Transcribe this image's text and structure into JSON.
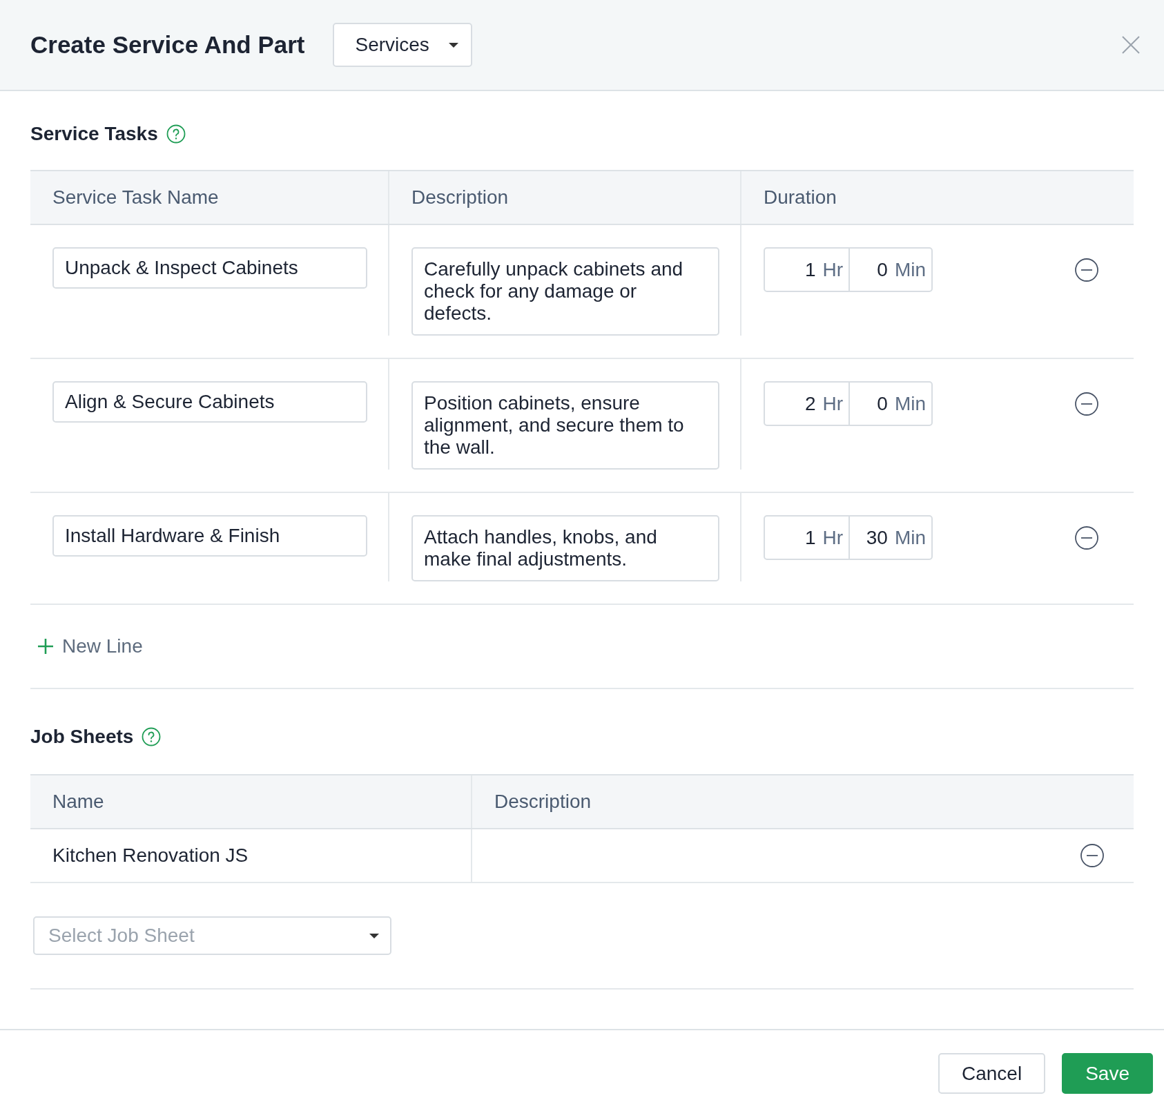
{
  "header": {
    "title": "Create Service And Part",
    "type_dropdown": "Services"
  },
  "service_tasks": {
    "title": "Service Tasks",
    "columns": [
      "Service Task Name",
      "Description",
      "Duration"
    ],
    "rows": [
      {
        "name": "Unpack & Inspect Cabinets",
        "description": "Carefully unpack cabinets and check for any damage or defects.",
        "hours": "1",
        "hours_unit": "Hr",
        "minutes": "0",
        "minutes_unit": "Min"
      },
      {
        "name": "Align & Secure Cabinets",
        "description": "Position cabinets, ensure alignment, and secure them to the wall.",
        "hours": "2",
        "hours_unit": "Hr",
        "minutes": "0",
        "minutes_unit": "Min"
      },
      {
        "name": "Install Hardware & Finish",
        "description": "Attach handles, knobs, and make final adjustments.",
        "hours": "1",
        "hours_unit": "Hr",
        "minutes": "30",
        "minutes_unit": "Min"
      }
    ],
    "add_line": "New Line"
  },
  "job_sheets": {
    "title": "Job Sheets",
    "columns": [
      "Name",
      "Description"
    ],
    "rows": [
      {
        "name": "Kitchen Renovation JS"
      }
    ],
    "select": {
      "placeholder": "Select Job Sheet"
    }
  },
  "footer": {
    "buttons": [
      {
        "label": "Cancel",
        "kind": "secondary"
      },
      {
        "label": "Save",
        "kind": "primary"
      }
    ]
  }
}
